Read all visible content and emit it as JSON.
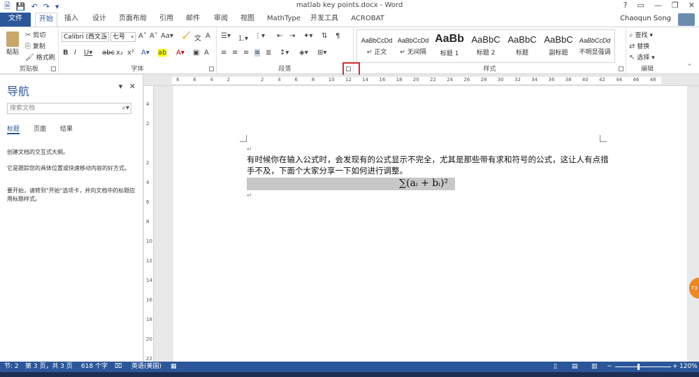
{
  "window": {
    "title": "matlab key points.docx - Word",
    "controls": [
      "?",
      "▭",
      "—",
      "❐",
      "✕"
    ],
    "quick_access": [
      "save-icon",
      "undo-icon",
      "redo-icon",
      "customize-icon"
    ]
  },
  "tabs": [
    "文件",
    "开始",
    "插入",
    "设计",
    "页面布局",
    "引用",
    "邮件",
    "审阅",
    "视图",
    "MathType",
    "开发工具",
    "ACROBAT"
  ],
  "user": {
    "name": "Chaoqun Song"
  },
  "ribbon": {
    "clipboard": {
      "label": "剪贴板",
      "paste": "粘贴",
      "cut": "剪切",
      "copy": "复制",
      "format_painter": "格式刷"
    },
    "font": {
      "label": "字体",
      "font_name": "Calibri (西文正",
      "font_size": "七号"
    },
    "paragraph": {
      "label": "段落"
    },
    "styles": {
      "label": "样式",
      "items": [
        {
          "sample": "AaBbCcDd",
          "name": "↵ 正文"
        },
        {
          "sample": "AaBbCcDd",
          "name": "↵ 无间隔"
        },
        {
          "sample": "AaBb",
          "name": "标题 1"
        },
        {
          "sample": "AaBbC",
          "name": "标题 2"
        },
        {
          "sample": "AaBbC",
          "name": "标题"
        },
        {
          "sample": "AaBbC",
          "name": "副标题"
        },
        {
          "sample": "AaBbCcDd",
          "name": "不明显强调"
        }
      ]
    },
    "editing": {
      "label": "编辑",
      "find": "查找",
      "replace": "替换",
      "select": "选择"
    }
  },
  "nav": {
    "title": "导航",
    "search_placeholder": "搜索文档",
    "tabs": [
      "标题",
      "页面",
      "结果"
    ],
    "msg1": "创建文档的交互式大纲。",
    "msg2": "它是跟踪您的具体位置或快速移动内容的好方式。",
    "msg3": "要开始，请转到\"开始\"选项卡，并向文档中的标题应用标题样式。"
  },
  "ruler": {
    "h_ticks": [
      "8",
      "6",
      "4",
      "2",
      "",
      "2",
      "4",
      "6",
      "8",
      "10",
      "12",
      "14",
      "16",
      "18",
      "20",
      "22",
      "24",
      "26",
      "28",
      "30",
      "32",
      "34",
      "36",
      "38",
      "40",
      "42",
      "44",
      "46",
      "48"
    ],
    "v_ticks": [
      "4",
      "2",
      "",
      "2",
      "4",
      "6",
      "8",
      "10",
      "12",
      "14",
      "16",
      "18",
      "20",
      "22"
    ]
  },
  "document": {
    "body": "有时候你在输入公式时，会发现有的公式显示不完全，尤其是那些带有求和符号的公式，这让人有点措手不及，下面个大家分享一下如何进行调整。",
    "formula": "∑(aᵢ + bᵢ)²",
    "para_mark": "↵"
  },
  "statusbar": {
    "section": "节: 2",
    "page": "第 3 页，共 3 页",
    "words": "618 个字",
    "lang": "英语(美国)",
    "zoom": "120%"
  },
  "side_bubble": "73",
  "colors": {
    "accent": "#2b579a",
    "highlight": "#d32f2f"
  }
}
